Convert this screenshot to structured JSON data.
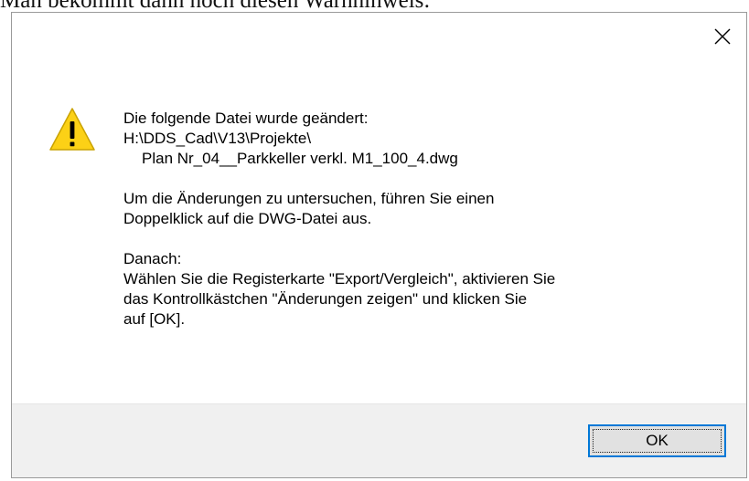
{
  "caption": "Man bekommt dann noch diesen Warnhinweis:",
  "dialog": {
    "close_glyph": "×",
    "icon": "warning-icon",
    "message": {
      "line1": "Die folgende Datei wurde geändert:",
      "line2": "H:\\DDS_Cad\\V13\\Projekte\\",
      "line3": "Plan Nr_04__Parkkeller verkl. M1_100_4.dwg",
      "line4": "Um die Änderungen zu untersuchen, führen Sie einen",
      "line5": "Doppelklick auf die DWG-Datei aus.",
      "line6": "Danach:",
      "line7": "Wählen Sie die Registerkarte \"Export/Vergleich\", aktivieren Sie",
      "line8": "das Kontrollkästchen \"Änderungen zeigen\" und klicken Sie",
      "line9": "auf [OK]."
    },
    "ok_label": "OK",
    "colors": {
      "footer_bg": "#f0f0f0",
      "button_bg": "#e1e1e1",
      "focus_border": "#0078d7",
      "warning_fill": "#fcd116"
    }
  }
}
